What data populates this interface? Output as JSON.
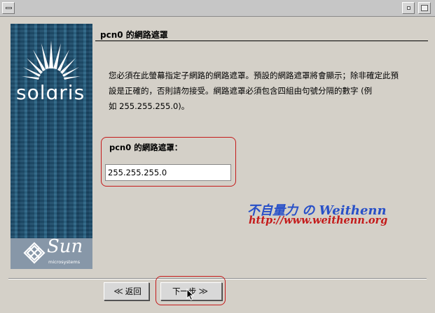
{
  "window": {
    "colors": {
      "background": "#d4d0c8",
      "banner": "#22506f"
    }
  },
  "banner": {
    "logo_text": "solɑris",
    "footer_brand": "Sun",
    "footer_sub": "microsystems"
  },
  "main": {
    "heading": "pcn0 的網路遮罩",
    "instructions": [
      "您必須在此螢幕指定子網路的網路遮罩。預設的網路遮罩將會顯示；除非確定此預",
      "設是正確的，否則請勿接受。網路遮罩必須包含四組由句號分隔的數字 (例",
      "如 255.255.255.0)。"
    ],
    "field_label": "pcn0 的網路遮罩：",
    "netmask_value": "255.255.255.0"
  },
  "watermark": {
    "title": "不自量力 の Weithenn",
    "url": "http://www.weithenn.org"
  },
  "footer": {
    "back_label": "返回",
    "next_label": "下一步"
  },
  "annotation_color": "#c41a1a"
}
